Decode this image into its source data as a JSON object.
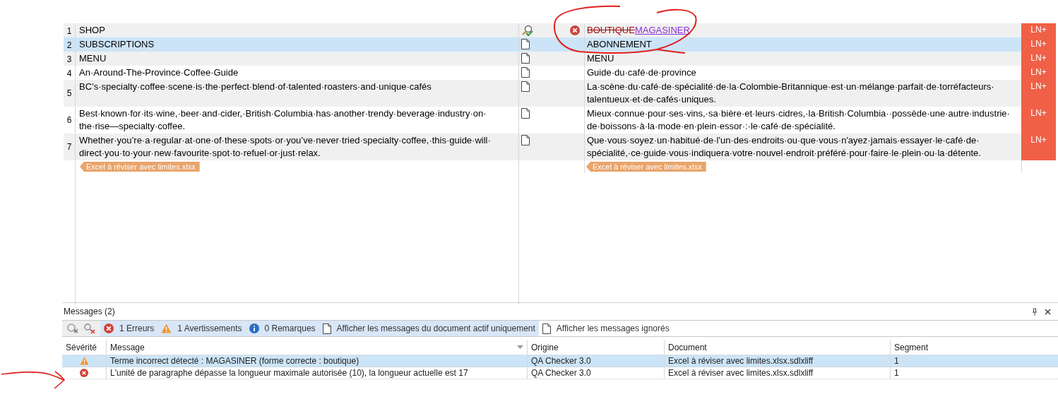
{
  "editor": {
    "segments": [
      {
        "number": "1",
        "source": "SHOP",
        "kind": "verified",
        "error": true,
        "selected": false,
        "target": [
          {
            "kind": "deleted",
            "text": "BOUTIQUE"
          },
          {
            "kind": "inserted",
            "text": "MAGASINER"
          }
        ],
        "flag": "LN+"
      },
      {
        "number": "2",
        "source": "SUBSCRIPTIONS",
        "kind": "document",
        "error": false,
        "selected": true,
        "target": [
          {
            "kind": "plain",
            "text": "ABONNEMENT"
          }
        ],
        "flag": "LN+"
      },
      {
        "number": "3",
        "source": "MENU",
        "kind": "document",
        "error": false,
        "selected": false,
        "target": [
          {
            "kind": "plain",
            "text": "MENU"
          }
        ],
        "flag": "LN+"
      },
      {
        "number": "4",
        "source": "An·Around-The-Province·Coffee·Guide",
        "kind": "document",
        "error": false,
        "selected": false,
        "target": [
          {
            "kind": "plain",
            "text": "Guide·du·café·de·province"
          }
        ],
        "flag": "LN+"
      },
      {
        "number": "5",
        "source": "BC’s·specialty·coffee·scene·is·the·perfect·blend·of·talented·roasters·and·unique·cafés",
        "kind": "document",
        "error": false,
        "selected": false,
        "target": [
          {
            "kind": "plain",
            "text": "La·scène·du·café·de·spécialité·de·la·Colombie-Britannique·est·un·mélange·parfait·de·torréfacteurs· talentueux·et·de·cafés·uniques."
          }
        ],
        "flag": "LN+"
      },
      {
        "number": "6",
        "source": "Best·known·for·its·wine,·beer·and·cider,·British·Columbia·has·another·trendy·beverage·industry·on· the·rise—specialty·coffee.",
        "kind": "document",
        "error": false,
        "selected": false,
        "target": [
          {
            "kind": "plain",
            "text": "Mieux·connue·pour·ses·vins,·sa·bière·et·leurs·cidres,·la·British·Columbia··possède·une·autre·industrie· de·boissons·à·la·mode·en·plein·essor·:·le·café·de·spécialité."
          }
        ],
        "flag": "LN+"
      },
      {
        "number": "7",
        "source": "Whether·you’re·a·regular·at·one·of·these·spots·or·you’ve·never·tried·specialty·coffee,·this·guide·will· direct·you·to·your·new·favourite·spot·to·refuel·or·just·relax.",
        "kind": "document",
        "error": false,
        "selected": false,
        "target": [
          {
            "kind": "plain",
            "text": "Que·vous·soyez·un·habitué·de·l'un·des·endroits·ou·que·vous·n'ayez·jamais·essayer·le·café·de· spécialité,·ce·guide·vous·indiquera·votre·nouvel·endroit·préféré·pour·faire·le·plein·ou·la·détente."
          }
        ],
        "flag": "LN+"
      }
    ],
    "source_file_tag": "Excel à réviser avec limites.xlsx",
    "target_file_tag": "Excel à réviser avec limites.xlsx"
  },
  "messages_panel": {
    "title": "Messages (2)",
    "filters": [
      {
        "kind": "error",
        "label": "1 Erreurs",
        "selected": true
      },
      {
        "kind": "warning",
        "label": "1 Avertissements",
        "selected": true
      },
      {
        "kind": "info",
        "label": "0 Remarques",
        "selected": true
      },
      {
        "kind": "document",
        "label": "Afficher les messages du document actif uniquement",
        "selected": true
      },
      {
        "kind": "document",
        "label": "Afficher les messages ignorés",
        "selected": false
      }
    ],
    "columns": [
      "Sévérité",
      "Message",
      "Origine",
      "Document",
      "Segment"
    ],
    "rows": [
      {
        "kind": "warning",
        "selected": true,
        "message": "Terme incorrect détecté : MAGASINER (forme correcte : boutique)",
        "origin": "QA Checker 3.0",
        "document": "Excel à réviser avec limites.xlsx.sdlxliff",
        "segment": "1"
      },
      {
        "kind": "error",
        "selected": false,
        "message": "L'unité de paragraphe dépasse la longueur maximale autorisée (10), la longueur actuelle est 17",
        "origin": "QA Checker 3.0",
        "document": "Excel à réviser avec limites.xlsx.sdlxliff",
        "segment": "1"
      }
    ]
  }
}
